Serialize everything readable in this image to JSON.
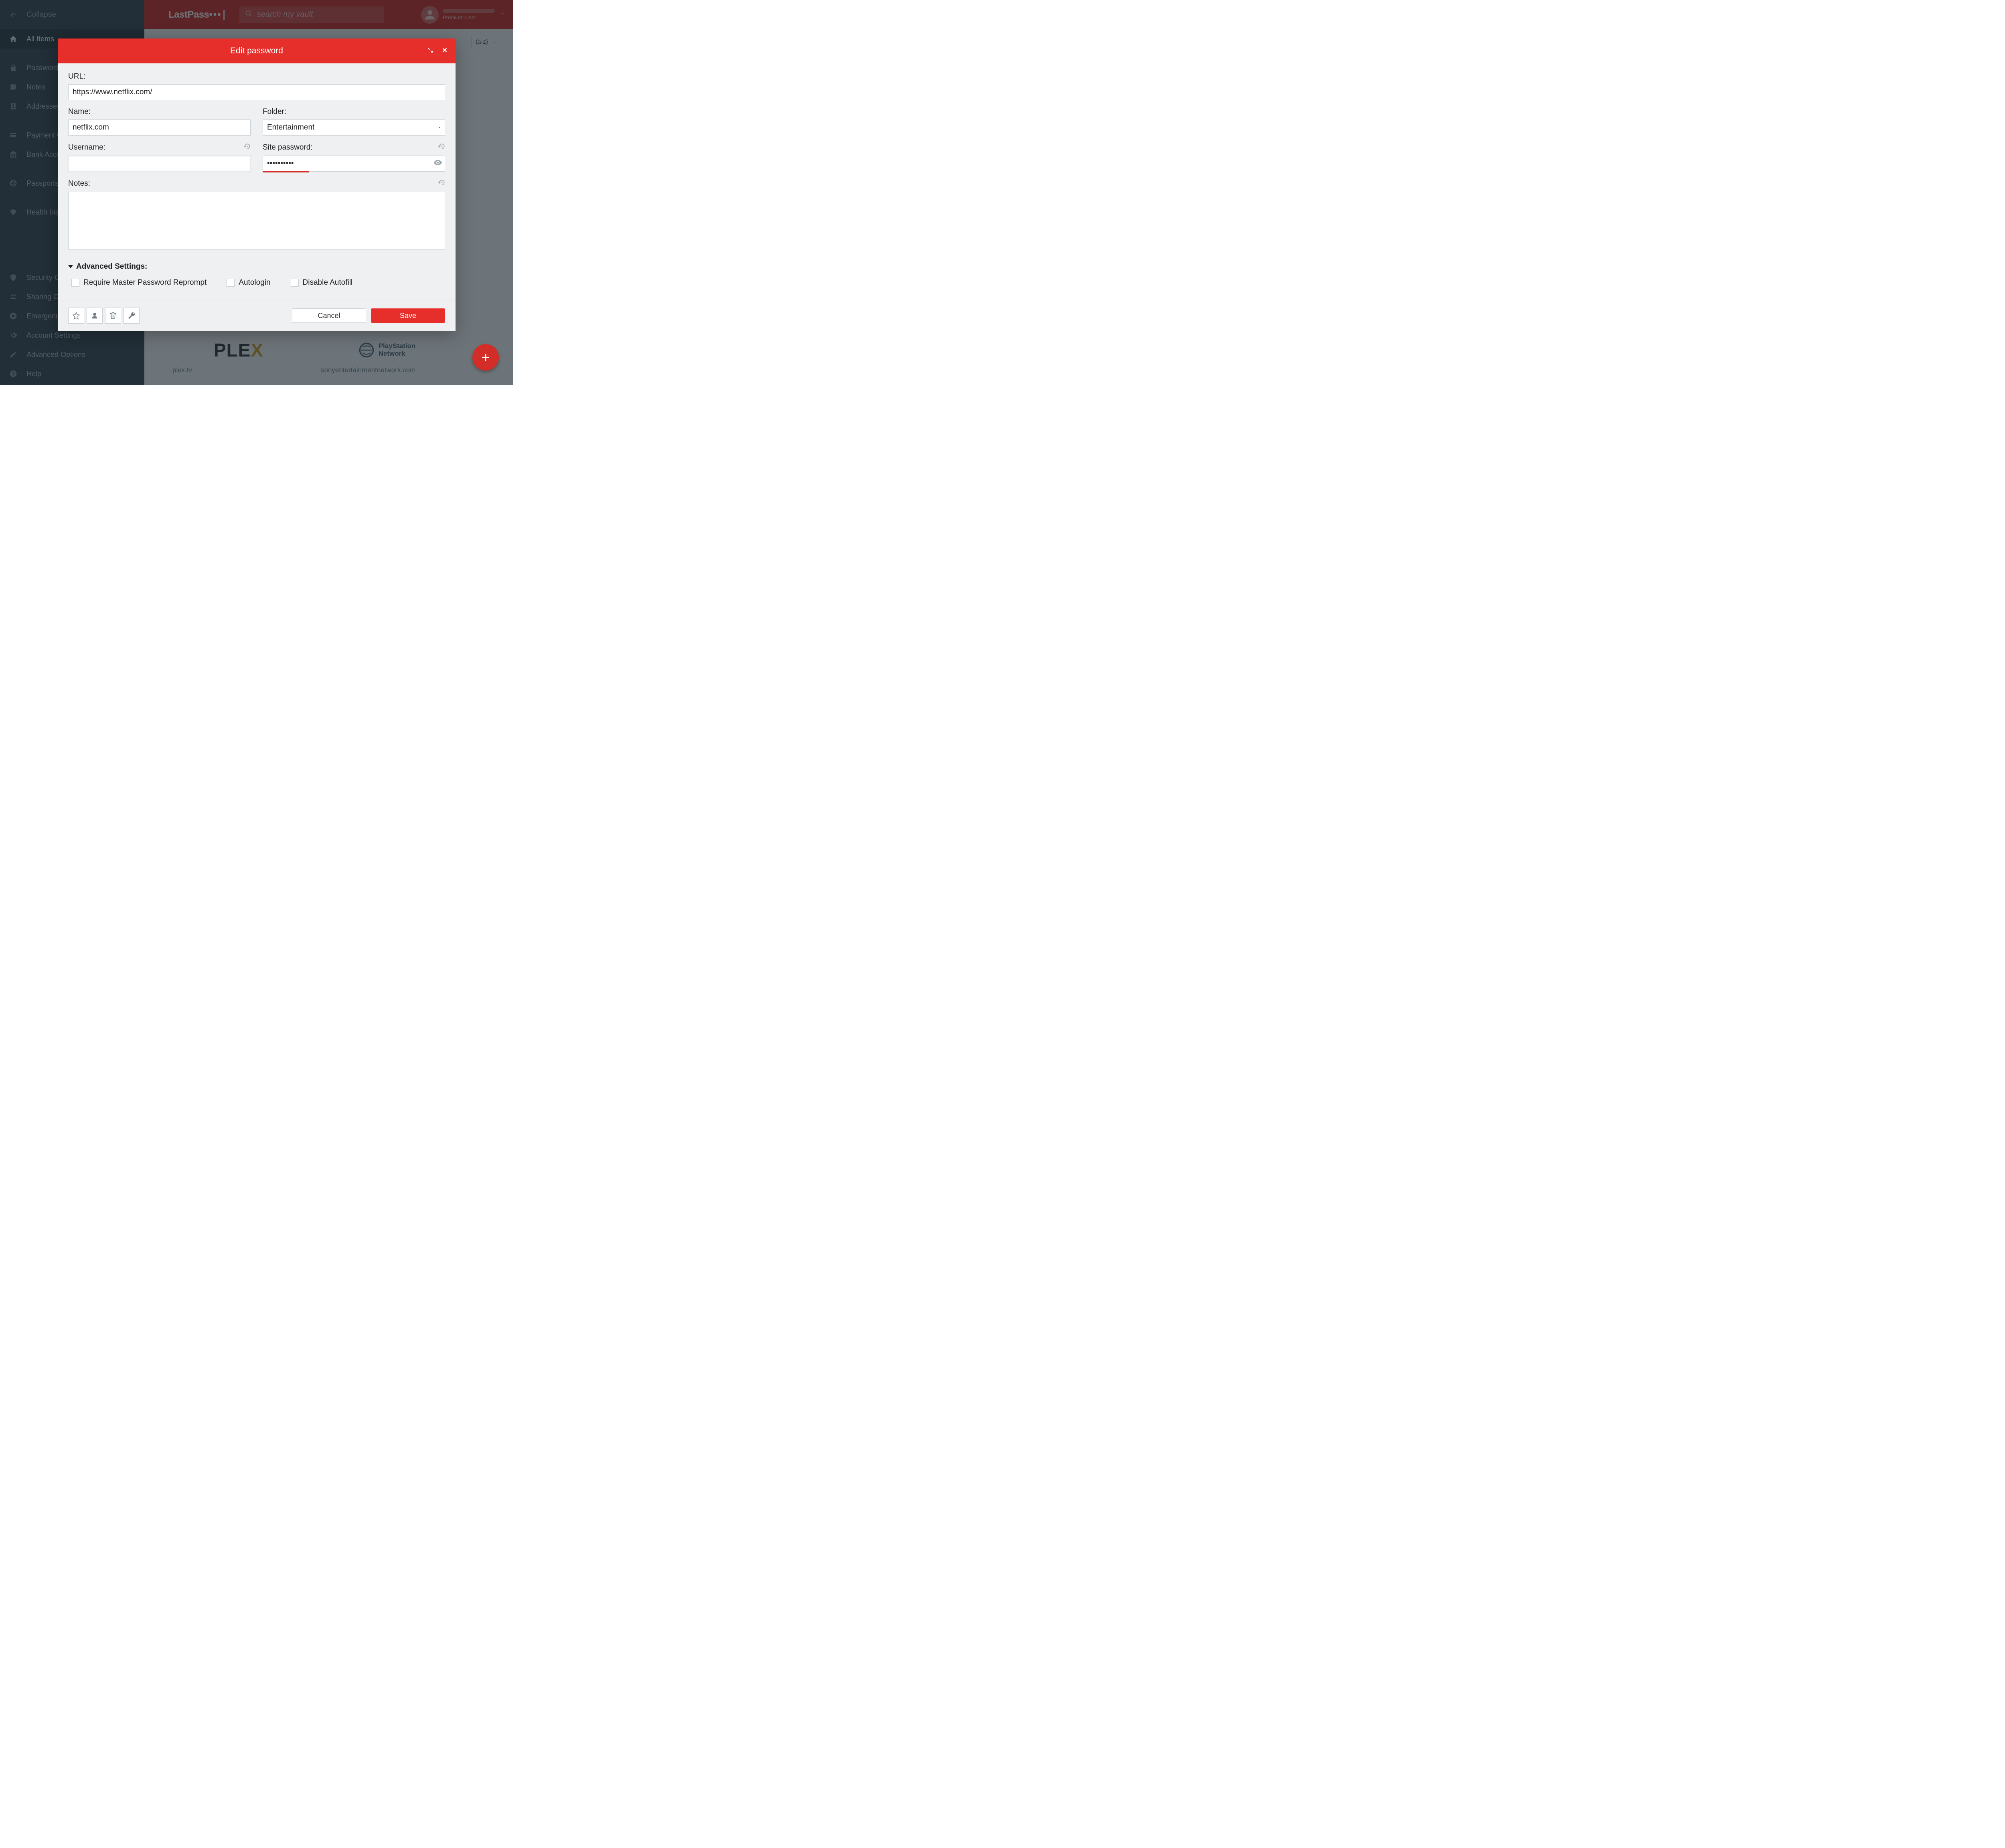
{
  "header": {
    "logo": "LastPass",
    "search_placeholder": "search my vault",
    "user_type": "Premium User"
  },
  "sidebar": {
    "collapse": "Collapse",
    "items": [
      {
        "label": "All Items",
        "icon": "home"
      },
      {
        "label": "Passwords",
        "icon": "lock"
      },
      {
        "label": "Notes",
        "icon": "note"
      },
      {
        "label": "Addresses",
        "icon": "address"
      },
      {
        "label": "Payment Cards",
        "icon": "card"
      },
      {
        "label": "Bank Accounts",
        "icon": "bank"
      },
      {
        "label": "Passports",
        "icon": "globe"
      },
      {
        "label": "Health Insurance",
        "icon": "heart"
      },
      {
        "label": "Security Challenge",
        "icon": "shield"
      },
      {
        "label": "Sharing Center",
        "icon": "people"
      },
      {
        "label": "Emergency Access",
        "icon": "lifebuoy"
      },
      {
        "label": "Account Settings",
        "icon": "gear"
      },
      {
        "label": "Advanced Options",
        "icon": "pencil"
      },
      {
        "label": "Help",
        "icon": "help"
      }
    ]
  },
  "main": {
    "sort": "(a-z)",
    "cards": [
      {
        "title": "plex.tv"
      },
      {
        "title": "sonyentertainmentnetwork.com"
      }
    ],
    "psn_line1": "PlayStation",
    "psn_line2": "Network"
  },
  "dialog": {
    "title": "Edit password",
    "labels": {
      "url": "URL:",
      "name": "Name:",
      "folder": "Folder:",
      "username": "Username:",
      "password": "Site password:",
      "notes": "Notes:",
      "advanced": "Advanced Settings:"
    },
    "values": {
      "url": "https://www.netflix.com/",
      "name": "netflix.com",
      "folder": "Entertainment",
      "username": "",
      "password": "••••••••••",
      "notes": ""
    },
    "advanced": {
      "reprompt": "Require Master Password Reprompt",
      "autologin": "Autologin",
      "disable_autofill": "Disable Autofill"
    },
    "footer": {
      "cancel": "Cancel",
      "save": "Save"
    }
  }
}
